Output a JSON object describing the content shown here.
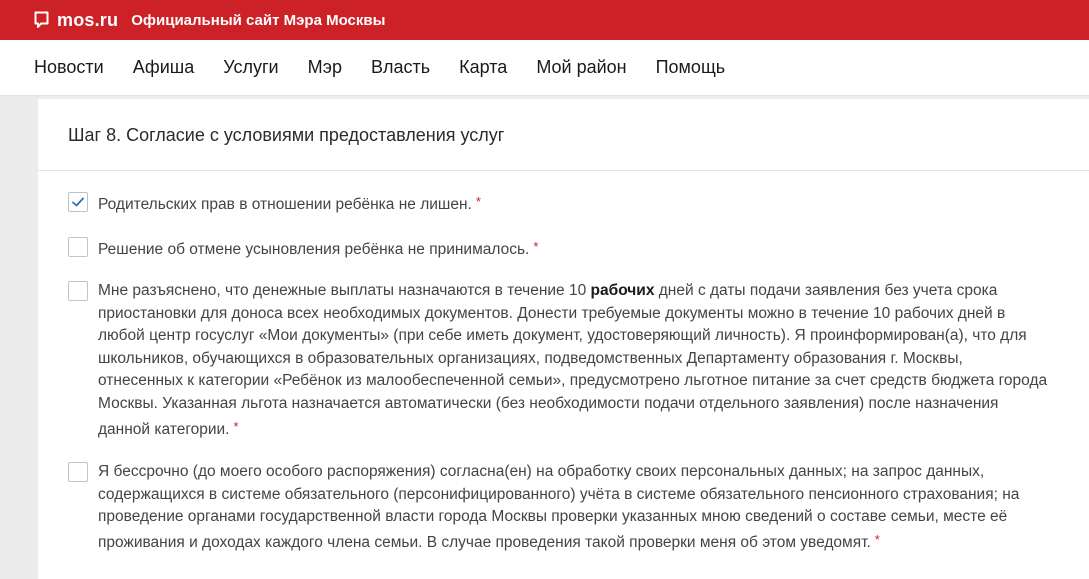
{
  "header": {
    "logo_text": "mos.ru",
    "site_title": "Официальный сайт Мэра Москвы",
    "brand_color": "#cc2127"
  },
  "nav": {
    "items": [
      "Новости",
      "Афиша",
      "Услуги",
      "Мэр",
      "Власть",
      "Карта",
      "Мой район",
      "Помощь"
    ]
  },
  "form": {
    "step_title": "Шаг 8. Согласие с условиями предоставления услуг",
    "required_mark": "*",
    "items": [
      {
        "checked": true,
        "text": "Родительских прав в отношении ребёнка не лишен."
      },
      {
        "checked": false,
        "text": "Решение об отмене усыновления ребёнка не принималось."
      },
      {
        "checked": false,
        "text_before": "Мне разъяснено, что денежные выплаты назначаются в течение 10 ",
        "text_bold": "рабочих",
        "text_after": " дней с даты подачи заявления без учета срока приостановки для доноса всех необходимых документов. Донести требуемые документы можно в течение 10 рабочих дней в любой центр госуслуг «Мои документы» (при себе иметь документ, удостоверяющий личность). Я проинформирован(а), что для школьников, обучающихся в образовательных организациях, подведомственных Департаменту образования г. Москвы, отнесенных к категории «Ребёнок из малообеспеченной семьи», предусмотрено льготное питание за счет средств бюджета города Москвы. Указанная льгота назначается автоматически (без необходимости подачи отдельного заявления) после назначения данной категории."
      },
      {
        "checked": false,
        "text": "Я бессрочно (до моего особого распоряжения) согласна(ен) на обработку своих персональных данных; на запрос данных, содержащихся в системе обязательного (персонифицированного) учёта в системе обязательного пенсионного страхования; на проведение органами государственной власти города Москвы проверки указанных мною сведений о составе семьи, месте её проживания и доходах каждого члена семьи. В случае проведения такой проверки меня об этом уведомят."
      }
    ]
  }
}
